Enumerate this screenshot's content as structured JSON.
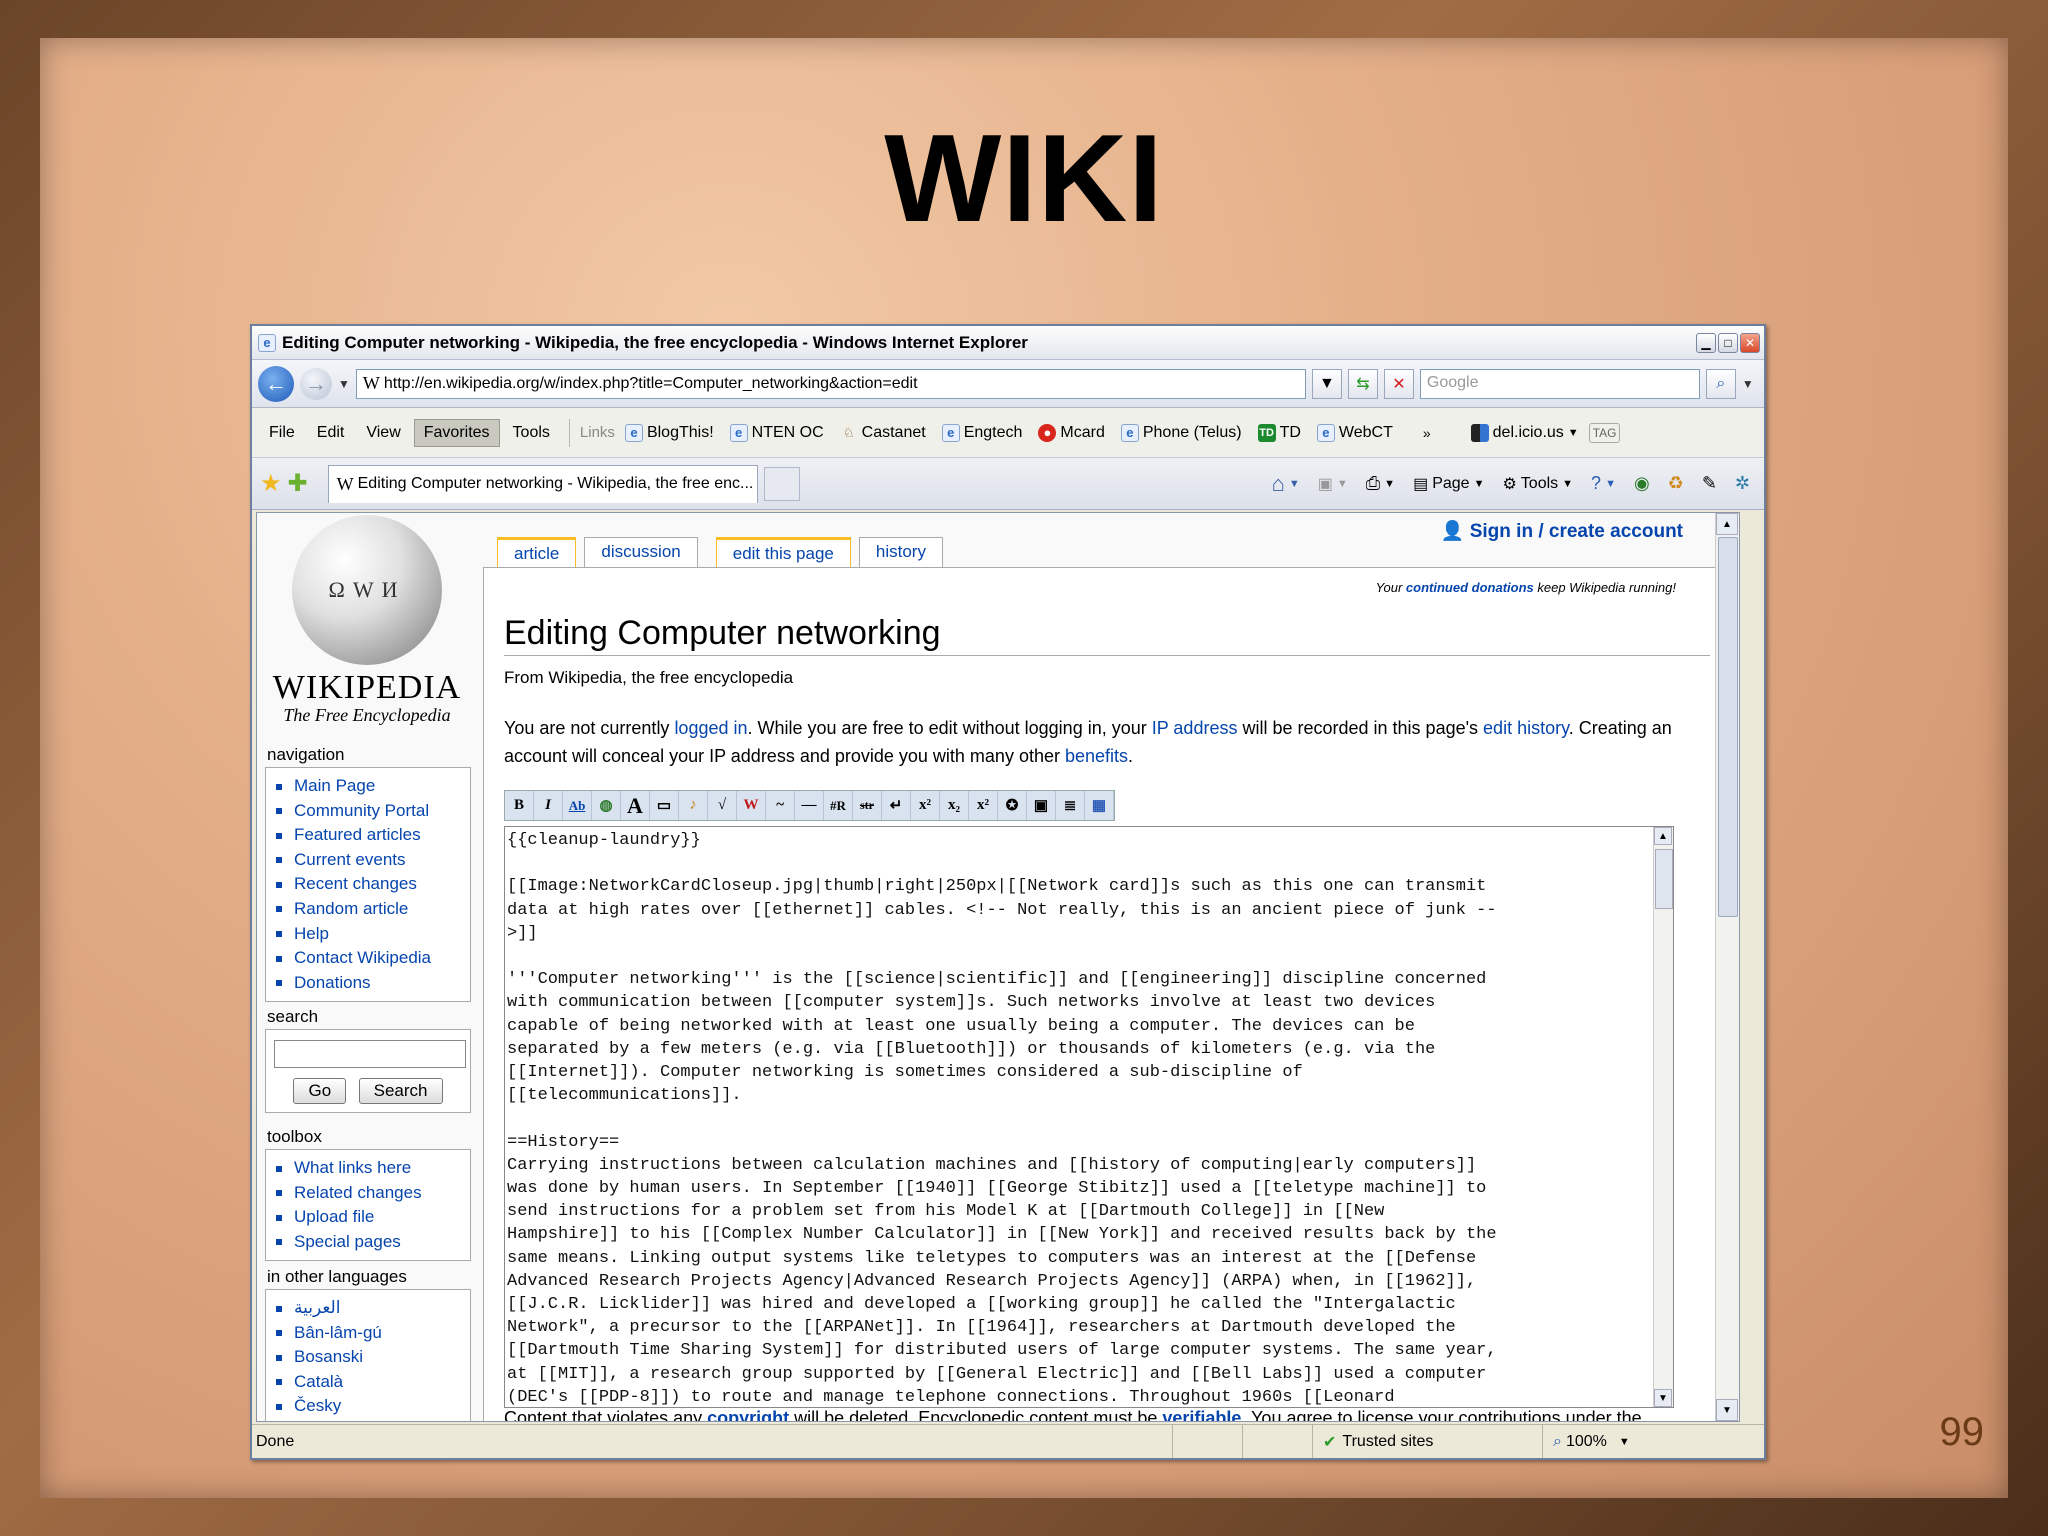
{
  "slide": {
    "title": "WIKI",
    "page_number": "99"
  },
  "window": {
    "title": "Editing Computer networking - Wikipedia, the free encyclopedia - Windows Internet Explorer"
  },
  "address": {
    "url": "http://en.wikipedia.org/w/index.php?title=Computer_networking&action=edit",
    "search_placeholder": "Google"
  },
  "menu": [
    "File",
    "Edit",
    "View",
    "Favorites",
    "Tools"
  ],
  "links": {
    "label": "Links",
    "items": [
      "BlogThis!",
      "NTEN OC",
      "Castanet",
      "Engtech",
      "Mcard",
      "Phone (Telus)",
      "TD",
      "WebCT"
    ],
    "delicious": "del.icio.us",
    "tag": "TAG"
  },
  "tab": {
    "title": "Editing Computer networking - Wikipedia, the free enc..."
  },
  "commands": {
    "page": "Page",
    "tools": "Tools"
  },
  "wiki": {
    "logo_name": "WIKIPEDIA",
    "logo_tagline": "The Free Encyclopedia",
    "navigation": {
      "title": "navigation",
      "items": [
        "Main Page",
        "Community Portal",
        "Featured articles",
        "Current events",
        "Recent changes",
        "Random article",
        "Help",
        "Contact Wikipedia",
        "Donations"
      ]
    },
    "search": {
      "title": "search",
      "go": "Go",
      "search": "Search"
    },
    "toolbox": {
      "title": "toolbox",
      "items": [
        "What links here",
        "Related changes",
        "Upload file",
        "Special pages"
      ]
    },
    "languages": {
      "title": "in other languages",
      "items": [
        "العربية",
        "Bân-lâm-gú",
        "Bosanski",
        "Català",
        "Česky"
      ]
    },
    "user_link": "Sign in / create account",
    "tabs": [
      "article",
      "discussion",
      "edit this page",
      "history"
    ],
    "donate": {
      "pre": "Your ",
      "link": "continued donations",
      "post": " keep Wikipedia running!"
    },
    "heading": "Editing Computer networking",
    "site_sub": "From Wikipedia, the free encyclopedia",
    "notice": {
      "p1": "You are not currently ",
      "l1": "logged in",
      "p2": ". While you are free to edit without logging in, your ",
      "l2": "IP address",
      "p3": " will be recorded in this page's ",
      "l3": "edit history",
      "p4": ". Creating an account will conceal your IP address and provide you with many other ",
      "l4": "benefits",
      "p5": "."
    },
    "edit_text": "{{cleanup-laundry}}\n\n[[Image:NetworkCardCloseup.jpg|thumb|right|250px|[[Network card]]s such as this one can transmit\ndata at high rates over [[ethernet]] cables. <!-- Not really, this is an ancient piece of junk --\n>]]\n\n'''Computer networking''' is the [[science|scientific]] and [[engineering]] discipline concerned\nwith communication between [[computer system]]s. Such networks involve at least two devices\ncapable of being networked with at least one usually being a computer. The devices can be\nseparated by a few meters (e.g. via [[Bluetooth]]) or thousands of kilometers (e.g. via the\n[[Internet]]). Computer networking is sometimes considered a sub-discipline of\n[[telecommunications]].\n\n==History==\nCarrying instructions between calculation machines and [[history of computing|early computers]]\nwas done by human users. In September [[1940]] [[George Stibitz]] used a [[teletype machine]] to\nsend instructions for a problem set from his Model K at [[Dartmouth College]] in [[New\nHampshire]] to his [[Complex Number Calculator]] in [[New York]] and received results back by the\nsame means. Linking output systems like teletypes to computers was an interest at the [[Defense\nAdvanced Research Projects Agency|Advanced Research Projects Agency]] (ARPA) when, in [[1962]],\n[[J.C.R. Licklider]] was hired and developed a [[working group]] he called the \"Intergalactic\nNetwork\", a precursor to the [[ARPANet]]. In [[1964]], researchers at Dartmouth developed the\n[[Dartmouth Time Sharing System]] for distributed users of large computer systems. The same year,\nat [[MIT]], a research group supported by [[General Electric]] and [[Bell Labs]] used a computer\n(DEC's [[PDP-8]]) to route and manage telephone connections. Throughout 1960s [[Leonard",
    "footer": {
      "p1": "Content that violates any ",
      "l1": "copyright",
      "p2": " will be deleted. Encyclopedic content must be ",
      "l2": "verifiable",
      "p3": ". You agree to license your contributions under the"
    }
  },
  "status": {
    "text": "Done",
    "zone": "Trusted sites",
    "zoom": "100%"
  }
}
